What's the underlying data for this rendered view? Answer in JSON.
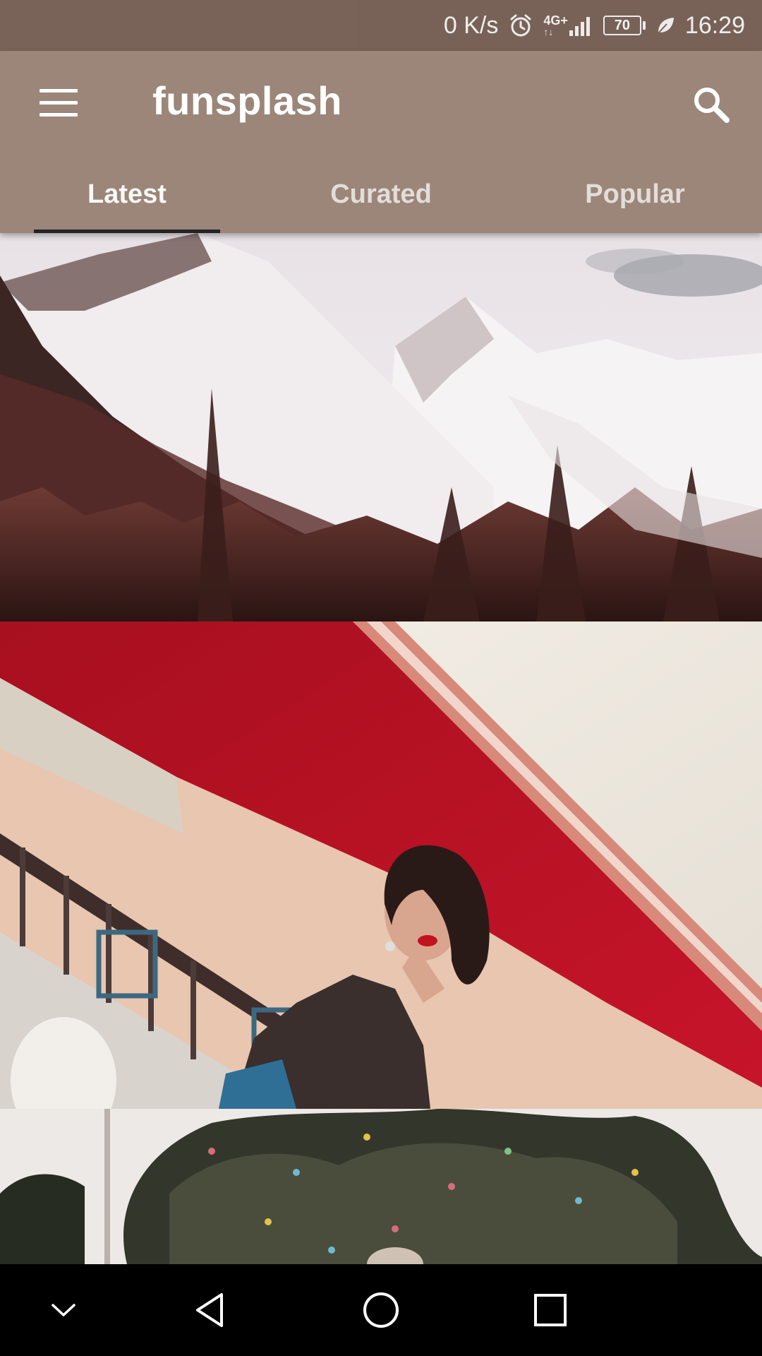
{
  "status_bar": {
    "net_speed": "0 K/s",
    "signal": "4G+",
    "battery": "70",
    "time": "16:29",
    "icons": [
      "alarm-icon",
      "signal-icon",
      "battery-icon",
      "leaf-icon"
    ]
  },
  "app_bar": {
    "title": "funsplash",
    "menu_icon": "hamburger-menu-icon",
    "search_icon": "search-icon",
    "tabs": [
      {
        "label": "Latest",
        "active": true
      },
      {
        "label": "Curated",
        "active": false
      },
      {
        "label": "Popular",
        "active": false
      }
    ]
  },
  "photos": [
    {
      "subject": "snowy-mountains"
    },
    {
      "subject": "woman-on-balcony"
    },
    {
      "subject": "tree-with-confetti"
    }
  ],
  "nav_bar": {
    "buttons": [
      "collapse-icon",
      "back-icon",
      "home-icon",
      "recents-icon"
    ]
  },
  "colors": {
    "status_bar": "#7b6459",
    "app_bar": "#9b8679",
    "indicator": "#222222"
  }
}
